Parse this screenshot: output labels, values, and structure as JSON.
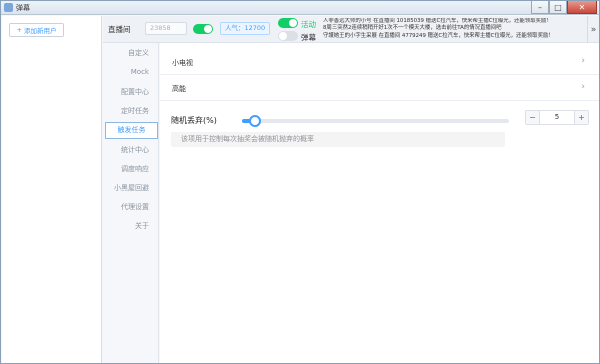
{
  "window": {
    "title": "弹幕",
    "min_glyph": "–",
    "max_glyph": "□",
    "close_glyph": "✕"
  },
  "left_panel": {
    "add_user_icon": "+",
    "add_user_label": "添加新用户"
  },
  "topbar": {
    "room_label": "直播间",
    "room_input_value": "23858",
    "room_toggle_on": true,
    "popularity": "人气：12700",
    "activity_label": "活动",
    "activity_on": true,
    "danmaku_label": "弹幕",
    "danmaku_on": false,
    "notice_lines": [
      "人非善远大师的小号 在直播间 10185039 赠送C拉汽车，快来帮主播C位曝光，还能领取奖励！",
      "8周三突然2连续稍稍开好1次不一个模天大楼，选击前往TA的情况直播间吧",
      "守護她王的小字生采展 在直播间 4779249 赠送C拉汽车，快来帮主播C位曝光，还能领取奖励！"
    ],
    "expand_glyph": "»"
  },
  "subnav": {
    "items": [
      {
        "label": "自定义",
        "active": false
      },
      {
        "label": "Mock",
        "active": false
      },
      {
        "label": "配置中心",
        "active": false
      },
      {
        "label": "定时任务",
        "active": false
      },
      {
        "label": "触发任务",
        "active": true
      },
      {
        "label": "统计中心",
        "active": false
      },
      {
        "label": "调度响应",
        "active": false
      },
      {
        "label": "小黑屋回避",
        "active": false
      },
      {
        "label": "代理设置",
        "active": false
      },
      {
        "label": "关于",
        "active": false
      }
    ]
  },
  "content": {
    "collapse_rows": [
      {
        "label": "小电视",
        "icon": "chevron-right-icon",
        "glyph": "›"
      },
      {
        "label": "高能",
        "icon": "chevron-right-icon",
        "glyph": "›"
      }
    ],
    "slider": {
      "label": "随机丢弃(%)",
      "value": 5,
      "min": 0,
      "max": 100,
      "minus_glyph": "−",
      "plus_glyph": "+"
    },
    "hint": "该项用于控制每次抽奖会被随机抛弃的概率"
  },
  "colors": {
    "accent": "#409eff",
    "toggle_on": "#13ce66",
    "toggle_off": "#dcdfe6"
  }
}
